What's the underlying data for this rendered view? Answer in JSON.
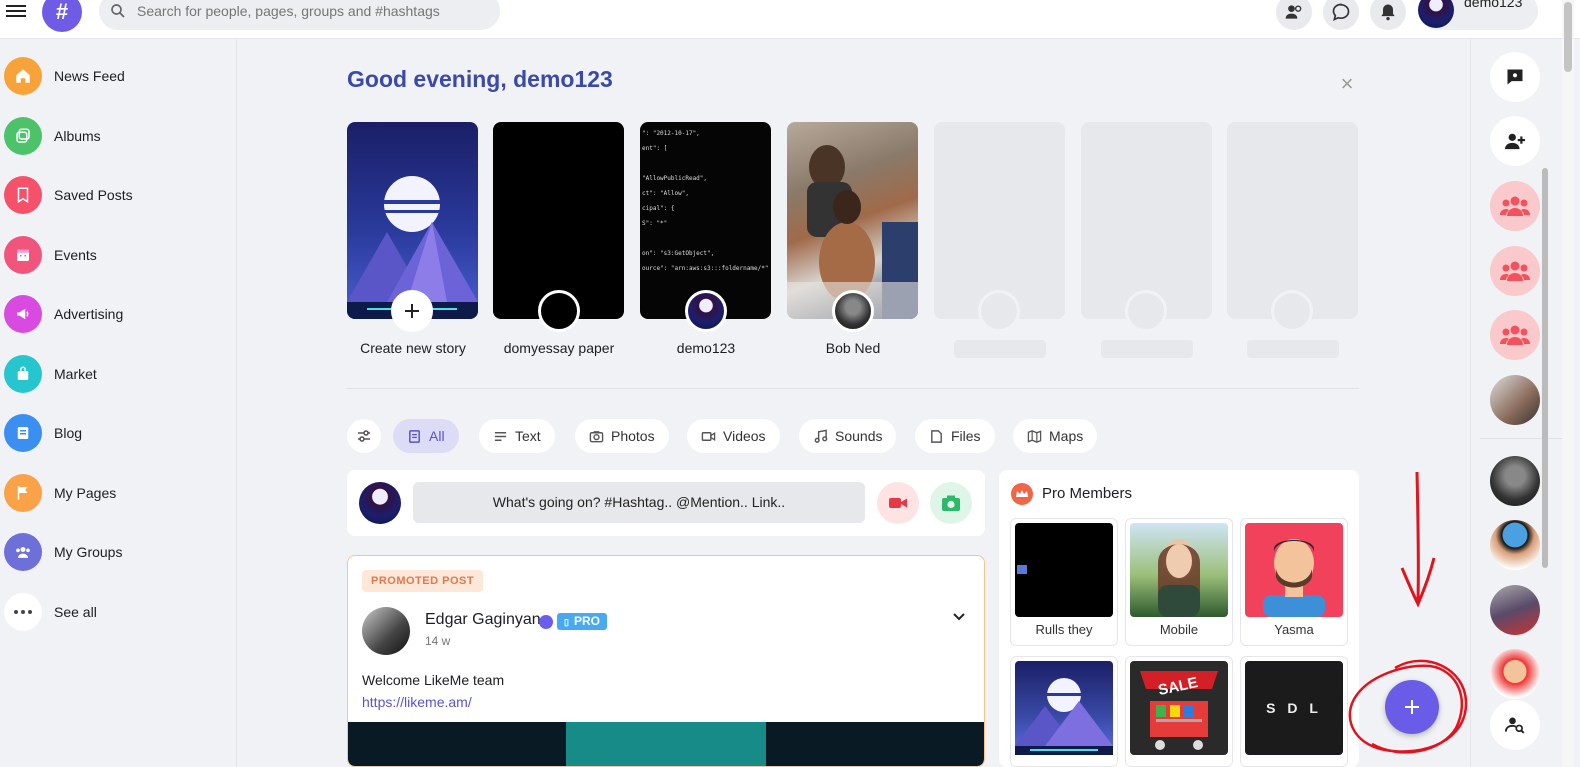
{
  "topbar": {
    "logo_text": "#",
    "search_placeholder": "Search for people, pages, groups and #hashtags",
    "username": "demo123"
  },
  "sidebar": {
    "items": [
      {
        "label": "News Feed",
        "icon": "home-icon",
        "color": "#f7a33a"
      },
      {
        "label": "Albums",
        "icon": "albums-icon",
        "color": "#4cc36a"
      },
      {
        "label": "Saved Posts",
        "icon": "bookmark-icon",
        "color": "#f5516b"
      },
      {
        "label": "Events",
        "icon": "calendar-icon",
        "color": "#f2557c"
      },
      {
        "label": "Advertising",
        "icon": "megaphone-icon",
        "color": "#d84ae0"
      },
      {
        "label": "Market",
        "icon": "shopping-bag-icon",
        "color": "#27c6cf"
      },
      {
        "label": "Blog",
        "icon": "blog-icon",
        "color": "#3b8ff0"
      },
      {
        "label": "My Pages",
        "icon": "flag-icon",
        "color": "#f9a247"
      },
      {
        "label": "My Groups",
        "icon": "group-icon",
        "color": "#6d70d8"
      },
      {
        "label": "See all",
        "icon": "more-dots-icon",
        "color": "#ffffff"
      }
    ]
  },
  "main": {
    "greeting": "Good evening, demo123",
    "stories": [
      {
        "name": "Create new story"
      },
      {
        "name": "domyessay paper"
      },
      {
        "name": "demo123"
      },
      {
        "name": "Bob Ned"
      }
    ],
    "story_code_lines": [
      "\": \"2012-10-17\",",
      "ent\": [",
      "\"AllowPublicRead\",",
      "ct\": \"Allow\",",
      "cipal\": {",
      "S\": \"*\"",
      "on\": \"s3:GetObject\",",
      "ource\": \"arn:aws:s3:::foldername/*\""
    ],
    "filters": [
      "All",
      "Text",
      "Photos",
      "Videos",
      "Sounds",
      "Files",
      "Maps"
    ],
    "composer_placeholder": "What's going on? #Hashtag.. @Mention.. Link..",
    "post": {
      "badge": "PROMOTED POST",
      "author": "Edgar Gaginyan",
      "pro_label": "PRO",
      "time": "14 w",
      "text": "Welcome LikeMe team",
      "link": "https://likeme.am/"
    },
    "pro_members": {
      "title": "Pro Members",
      "members": [
        {
          "name": "Rulls they"
        },
        {
          "name": "Mobile"
        },
        {
          "name": "Yasma"
        }
      ],
      "sale_text": "SALE",
      "logo_text": "S D L"
    }
  },
  "colors": {
    "accent": "#6b5ce7",
    "greeting": "#3b4aa8",
    "annotation": "#e0141e"
  }
}
